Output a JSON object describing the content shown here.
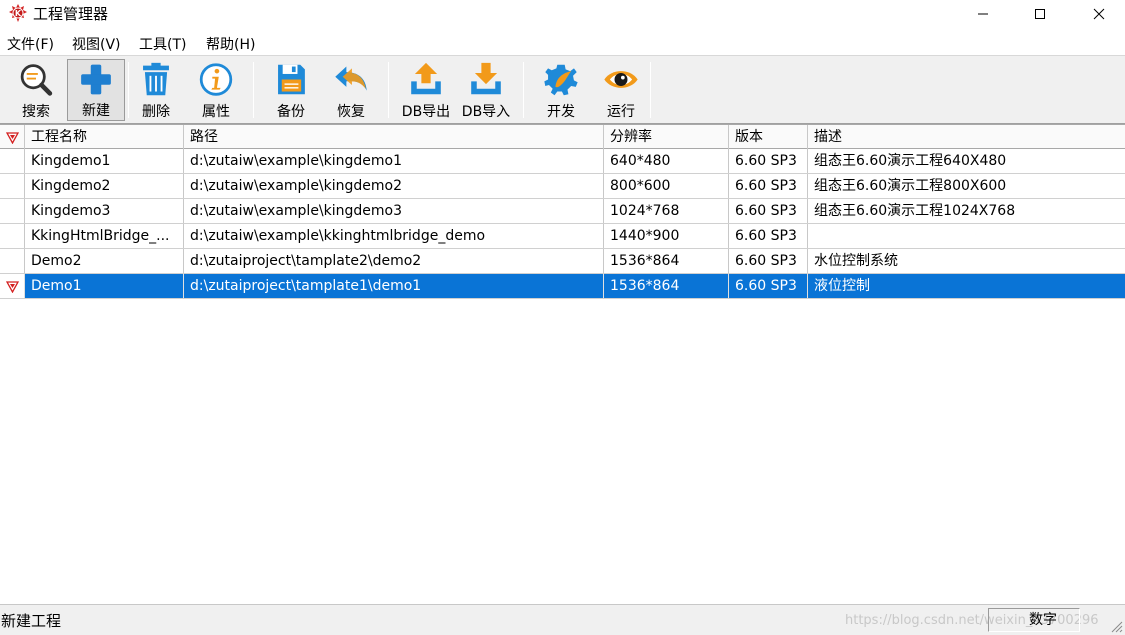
{
  "window": {
    "title": "工程管理器"
  },
  "menu": [
    "文件(F)",
    "视图(V)",
    "工具(T)",
    "帮助(H)"
  ],
  "toolbar": [
    {
      "label": "搜索",
      "icon": "search-icon"
    },
    {
      "label": "新建",
      "icon": "plus-icon",
      "pressed": true
    },
    {
      "label": "删除",
      "icon": "trash-icon"
    },
    {
      "label": "属性",
      "icon": "info-icon"
    },
    {
      "label": "备份",
      "icon": "save-disk-icon"
    },
    {
      "label": "恢复",
      "icon": "undo-arrow-icon"
    },
    {
      "label": "DB导出",
      "icon": "db-export-icon"
    },
    {
      "label": "DB导入",
      "icon": "db-import-icon"
    },
    {
      "label": "开发",
      "icon": "develop-gear-icon"
    },
    {
      "label": "运行",
      "icon": "run-eye-icon"
    }
  ],
  "table": {
    "columns": [
      "工程名称",
      "路径",
      "分辨率",
      "版本",
      "描述"
    ],
    "rows": [
      {
        "name": "Kingdemo1",
        "path": "d:\\zutaiw\\example\\kingdemo1",
        "resolution": "640*480",
        "version": "6.60 SP3",
        "desc": "组态王6.60演示工程640X480"
      },
      {
        "name": "Kingdemo2",
        "path": "d:\\zutaiw\\example\\kingdemo2",
        "resolution": "800*600",
        "version": "6.60 SP3",
        "desc": "组态王6.60演示工程800X600"
      },
      {
        "name": "Kingdemo3",
        "path": "d:\\zutaiw\\example\\kingdemo3",
        "resolution": "1024*768",
        "version": "6.60 SP3",
        "desc": "组态王6.60演示工程1024X768"
      },
      {
        "name": "KkingHtmlBridge_...",
        "path": "d:\\zutaiw\\example\\kkinghtmlbridge_demo",
        "resolution": "1440*900",
        "version": "6.60 SP3",
        "desc": ""
      },
      {
        "name": "Demo2",
        "path": "d:\\zutaiproject\\tamplate2\\demo2",
        "resolution": "1536*864",
        "version": "6.60 SP3",
        "desc": "水位控制系统"
      },
      {
        "name": "Demo1",
        "path": "d:\\zutaiproject\\tamplate1\\demo1",
        "resolution": "1536*864",
        "version": "6.60 SP3",
        "desc": "液位控制",
        "selected": true
      }
    ]
  },
  "status": {
    "text": "新建工程",
    "panel": "数字",
    "watermark": "https://blog.csdn.net/weixin_43700296"
  },
  "colors": {
    "selection": "#0a74d6",
    "icon_blue": "#1f8ad8",
    "icon_orange": "#f29a1a",
    "marker_red": "#d42020"
  }
}
